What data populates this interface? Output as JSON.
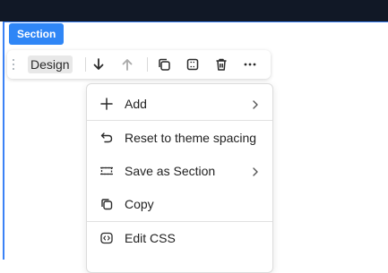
{
  "section_tag": "Section",
  "toolbar": {
    "design_label": "Design",
    "actions": [
      "drag-handle-icon",
      "move-down-icon",
      "move-up-icon",
      "duplicate-icon",
      "select-frame-icon",
      "delete-icon",
      "more-icon"
    ]
  },
  "menu": {
    "items": [
      {
        "label": "Add",
        "icon": "plus-icon",
        "submenu": true
      },
      {
        "label": "Reset to theme spacing",
        "icon": "undo-icon",
        "submenu": false
      },
      {
        "label": "Save as Section",
        "icon": "save-section-icon",
        "submenu": true
      },
      {
        "label": "Copy",
        "icon": "copy-icon",
        "submenu": false
      },
      {
        "label": "Edit CSS",
        "icon": "code-icon",
        "submenu": false
      }
    ]
  },
  "colors": {
    "accent": "#2f86f6",
    "topbar": "#111826",
    "frame": "#3b82f6"
  }
}
